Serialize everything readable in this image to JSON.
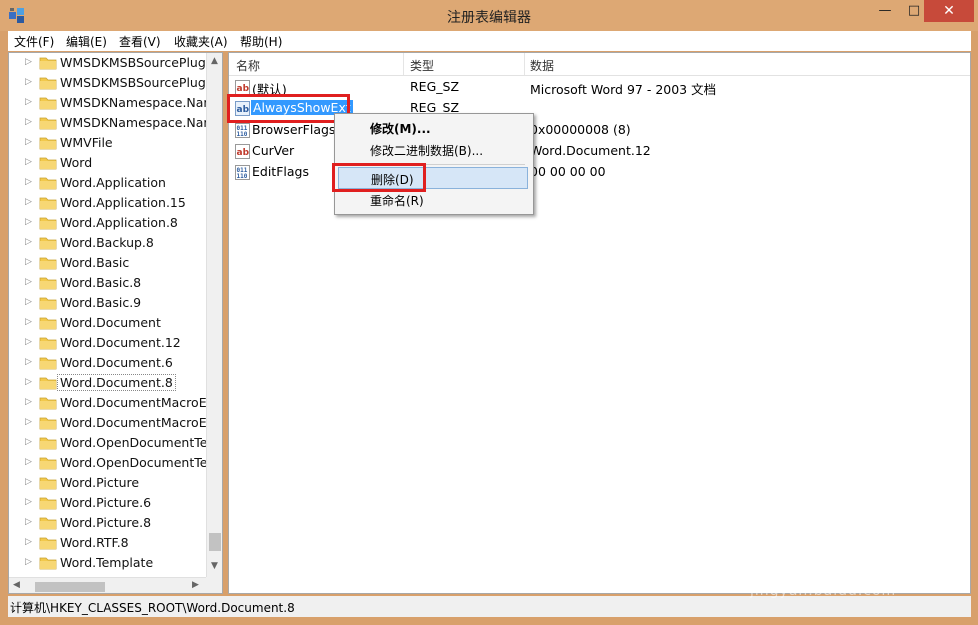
{
  "window": {
    "title": "注册表编辑器",
    "min_glyph": "—",
    "max_glyph": "□",
    "close_glyph": "✕"
  },
  "menu": [
    {
      "label": "文件(F)"
    },
    {
      "label": "编辑(E)"
    },
    {
      "label": "查看(V)"
    },
    {
      "label": "收藏夹(A)"
    },
    {
      "label": "帮助(H)"
    }
  ],
  "tree": {
    "items": [
      {
        "label": "WMSDKMSBSourcePlugin"
      },
      {
        "label": "WMSDKMSBSourcePlugin"
      },
      {
        "label": "WMSDKNamespace.Nam"
      },
      {
        "label": "WMSDKNamespace.Nam"
      },
      {
        "label": "WMVFile"
      },
      {
        "label": "Word"
      },
      {
        "label": "Word.Application"
      },
      {
        "label": "Word.Application.15"
      },
      {
        "label": "Word.Application.8"
      },
      {
        "label": "Word.Backup.8"
      },
      {
        "label": "Word.Basic"
      },
      {
        "label": "Word.Basic.8"
      },
      {
        "label": "Word.Basic.9"
      },
      {
        "label": "Word.Document"
      },
      {
        "label": "Word.Document.12"
      },
      {
        "label": "Word.Document.6"
      },
      {
        "label": "Word.Document.8",
        "selected": true
      },
      {
        "label": "Word.DocumentMacroEr"
      },
      {
        "label": "Word.DocumentMacroEr"
      },
      {
        "label": "Word.OpenDocumentTex"
      },
      {
        "label": "Word.OpenDocumentTex"
      },
      {
        "label": "Word.Picture"
      },
      {
        "label": "Word.Picture.6"
      },
      {
        "label": "Word.Picture.8"
      },
      {
        "label": "Word.RTF.8"
      },
      {
        "label": "Word.Template"
      }
    ]
  },
  "values": {
    "headers": {
      "name": "名称",
      "type": "类型",
      "data": "数据"
    },
    "rows": [
      {
        "icon": "string-value-icon",
        "name": "(默认)",
        "type": "REG_SZ",
        "data": "Microsoft Word 97 - 2003 文档"
      },
      {
        "icon": "string-value-icon",
        "name": "AlwaysShowExt",
        "type": "REG_SZ",
        "data": "",
        "selected": true
      },
      {
        "icon": "binary-value-icon",
        "name": "BrowserFlags",
        "type": "",
        "data": "0x00000008 (8)"
      },
      {
        "icon": "string-value-icon",
        "name": "CurVer",
        "type": "",
        "data": "Word.Document.12"
      },
      {
        "icon": "binary-value-icon",
        "name": "EditFlags",
        "type": "",
        "data": "00 00 00 00"
      }
    ]
  },
  "context_menu": {
    "modify": "修改(M)...",
    "modify_binary": "修改二进制数据(B)...",
    "delete": "删除(D)",
    "rename": "重命名(R)"
  },
  "status": {
    "path": "计算机\\HKEY_CLASSES_ROOT\\Word.Document.8"
  },
  "watermark": {
    "brand": "Bai",
    "brand2": "经验",
    "url": "jingyan.baidu.com"
  },
  "colors": {
    "titlebar": "#dda874",
    "selection": "#3399ff",
    "annotation": "#e01f1f",
    "close": "#c74a3a"
  }
}
